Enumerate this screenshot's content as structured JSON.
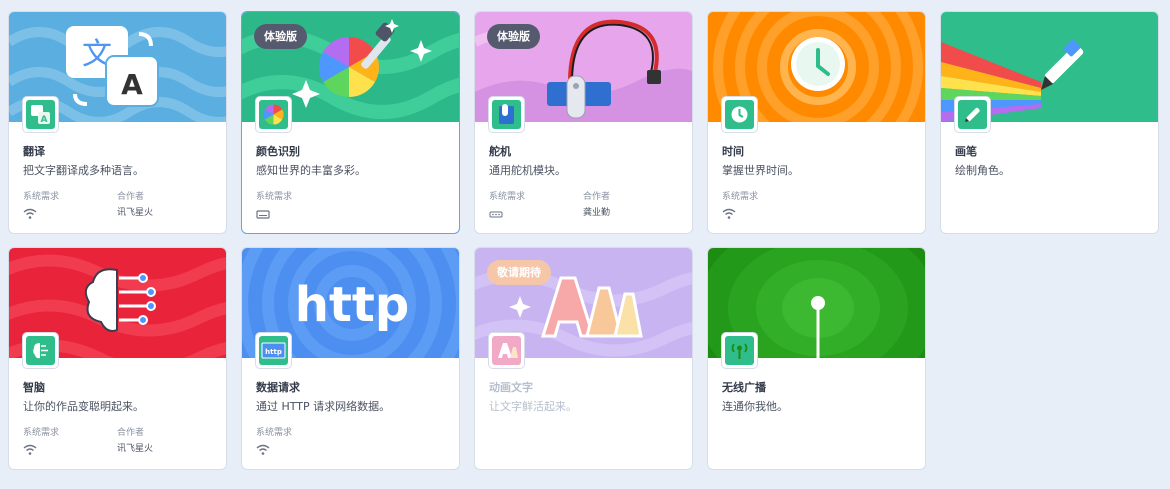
{
  "labels": {
    "requirements": "系统需求",
    "collaborator": "合作者"
  },
  "extensions": [
    {
      "title": "翻译",
      "description": "把文字翻译成多种语言。",
      "requirement_icon": "wifi-icon",
      "collaborator": "讯飞星火",
      "banner_color": "#5aaee0"
    },
    {
      "title": "颜色识别",
      "description": "感知世界的丰富多彩。",
      "badge": "体验版",
      "requirement_icon": "keyboard-icon",
      "banner_color": "#2db88a",
      "selected": true
    },
    {
      "title": "舵机",
      "description": "通用舵机模块。",
      "badge": "体验版",
      "requirement_icon": "device-icon",
      "collaborator": "龚业勤",
      "banner_color": "#e7a6ec"
    },
    {
      "title": "时间",
      "description": "掌握世界时间。",
      "requirement_icon": "wifi-icon",
      "banner_color": "#ff8a00"
    },
    {
      "title": "画笔",
      "description": "绘制角色。",
      "banner_color": "#2fbd8c"
    },
    {
      "title": "智脑",
      "description": "让你的作品变聪明起来。",
      "requirement_icon": "wifi-icon",
      "collaborator": "讯飞星火",
      "banner_color": "#e8233a"
    },
    {
      "title": "数据请求",
      "description": "通过 HTTP 请求网络数据。",
      "requirement_icon": "wifi-icon",
      "banner_color": "#4d8ff0",
      "banner_text": "http",
      "thumb_text": "http"
    },
    {
      "title": "动画文字",
      "description": "让文字鲜活起来。",
      "badge": "敬请期待",
      "disabled": true,
      "banner_color": "#c9b4f2"
    },
    {
      "title": "无线广播",
      "description": "连通你我他。",
      "banner_color": "#1d8c12"
    }
  ]
}
